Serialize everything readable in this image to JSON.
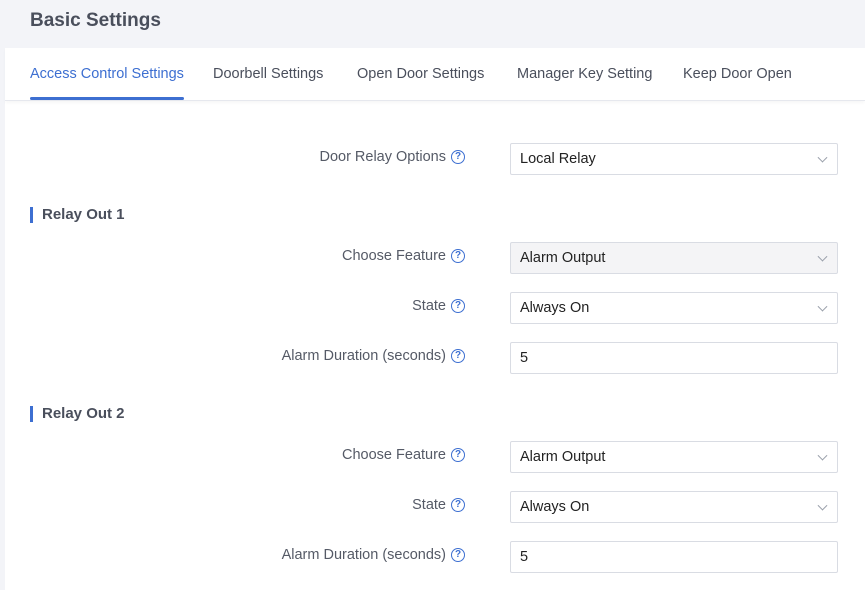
{
  "page": {
    "title": "Basic Settings"
  },
  "tabs": [
    {
      "label": "Access Control Settings",
      "active": true
    },
    {
      "label": "Doorbell Settings",
      "active": false
    },
    {
      "label": "Open Door Settings",
      "active": false
    },
    {
      "label": "Manager Key Setting",
      "active": false
    },
    {
      "label": "Keep Door Open",
      "active": false
    }
  ],
  "door_relay": {
    "label": "Door Relay Options",
    "value": "Local Relay"
  },
  "relay_out_1": {
    "title": "Relay Out 1",
    "feature_label": "Choose Feature",
    "feature_value": "Alarm Output",
    "state_label": "State",
    "state_value": "Always On",
    "duration_label": "Alarm Duration (seconds)",
    "duration_value": "5"
  },
  "relay_out_2": {
    "title": "Relay Out 2",
    "feature_label": "Choose Feature",
    "feature_value": "Alarm Output",
    "state_label": "State",
    "state_value": "Always On",
    "duration_label": "Alarm Duration (seconds)",
    "duration_value": "5"
  },
  "icons": {
    "help": "question-circle-icon",
    "dropdown": "chevron-down-icon"
  },
  "colors": {
    "accent": "#3d6fd1",
    "text": "#4a4f5c",
    "background": "#f3f4f8"
  }
}
